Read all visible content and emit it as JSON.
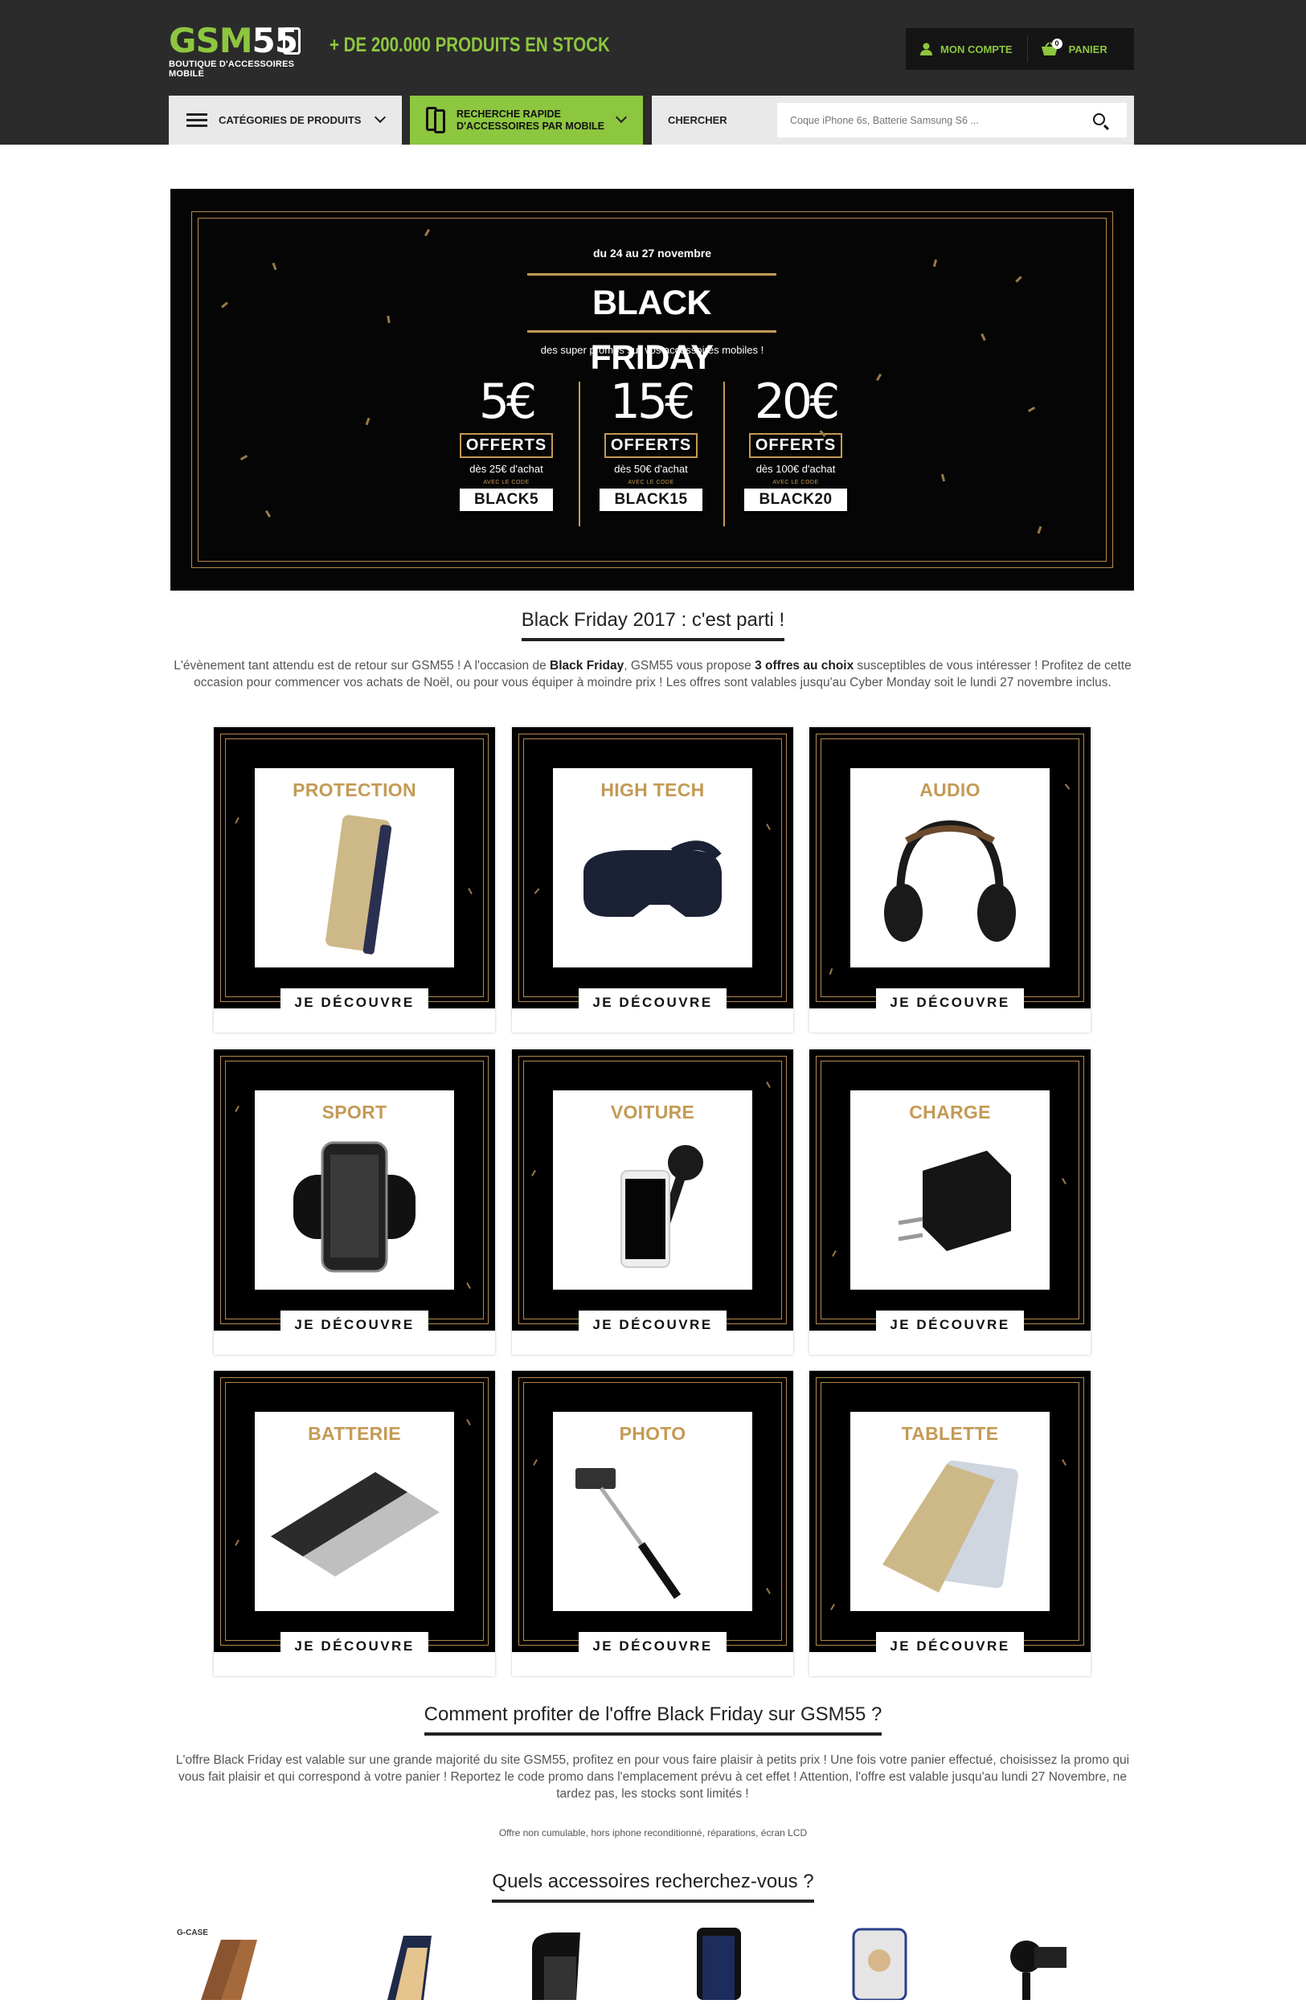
{
  "header": {
    "logo_text": "GSM55",
    "logo_subtitle": "BOUTIQUE D'ACCESSOIRES MOBILE",
    "tagline": "+ DE 200.000 PRODUITS EN STOCK",
    "account_label": "MON COMPTE",
    "cart_label": "PANIER",
    "cart_count": "0",
    "categories_label": "CATÉGORIES DE PRODUITS",
    "quick_search_label": "RECHERCHE RAPIDE D'ACCESSOIRES PAR MOBILE",
    "search_label": "CHERCHER",
    "search_placeholder": "Coque iPhone 6s, Batterie Samsung S6 ...",
    "brand_color": "#8dc63f"
  },
  "banner": {
    "dates": "du 24 au 27 novembre",
    "title": "BLACK FRIDAY",
    "subtitle": "des super promos sur vos accessoires mobiles !",
    "offers": [
      {
        "amount": "5€",
        "label": "OFFERTS",
        "condition": "dès 25€ d'achat",
        "code_label": "AVEC LE CODE",
        "code": "BLACK5"
      },
      {
        "amount": "15€",
        "label": "OFFERTS",
        "condition": "dès 50€ d'achat",
        "code_label": "AVEC LE CODE",
        "code": "BLACK15"
      },
      {
        "amount": "20€",
        "label": "OFFERTS",
        "condition": "dès 100€ d'achat",
        "code_label": "AVEC LE CODE",
        "code": "BLACK20"
      }
    ],
    "gold_color": "#c49a55"
  },
  "intro": {
    "heading": "Black Friday 2017 : c'est parti !",
    "text_before": "L'évènement tant attendu est de retour sur GSM55 ! A l'occasion de ",
    "bold1": "Black Friday",
    "text_mid": ", GSM55 vous propose ",
    "bold2": "3 offres au choix",
    "text_after": " susceptibles de vous intéresser ! Profitez de cette occasion pour commencer vos achats de Noël, ou pour vous équiper à moindre prix ! Les offres sont valables jusqu'au Cyber Monday soit le lundi 27 novembre inclus."
  },
  "categories": {
    "button_label": "JE DÉCOUVRE",
    "items": [
      "PROTECTION",
      "HIGH TECH",
      "AUDIO",
      "SPORT",
      "VOITURE",
      "CHARGE",
      "BATTERIE",
      "PHOTO",
      "TABLETTE"
    ]
  },
  "how_to": {
    "heading": "Comment profiter de l'offre Black Friday sur GSM55 ?",
    "text": "L'offre Black Friday est valable sur une grande majorité du site GSM55, profitez en pour vous faire plaisir à petits prix ! Une fois votre panier effectué, choisissez la promo qui vous fait plaisir et qui correspond à votre panier ! Reportez le code promo dans l'emplacement prévu à cet effet ! Attention, l'offre est valable jusqu'au lundi 27 Novembre, ne tardez pas, les stocks sont limités !",
    "note": "Offre non cumulable, hors iphone reconditionné, réparations, écran LCD"
  },
  "accessories": {
    "heading": "Quels accessoires recherchez-vous ?",
    "brand_tag": "G-CASE"
  }
}
